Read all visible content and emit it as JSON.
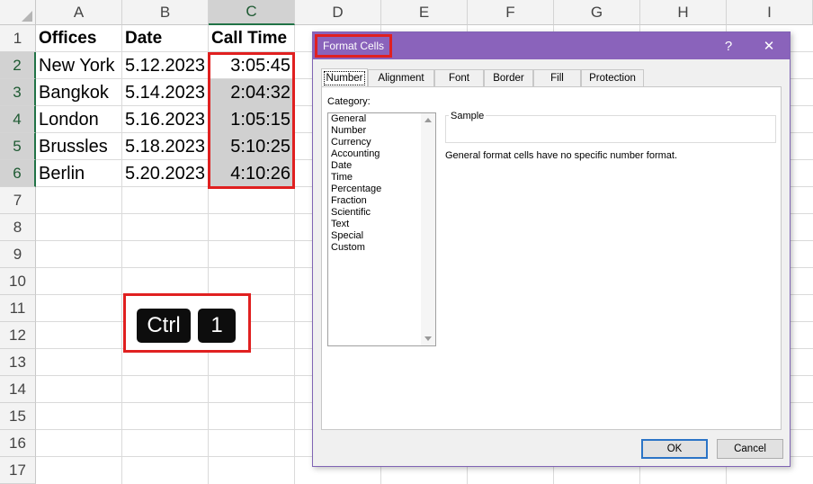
{
  "spreadsheet": {
    "columns": [
      "A",
      "B",
      "C",
      "D",
      "E",
      "F",
      "G",
      "H",
      "I"
    ],
    "rows": [
      "1",
      "2",
      "3",
      "4",
      "5",
      "6",
      "7",
      "8",
      "9",
      "10",
      "11",
      "12",
      "13",
      "14",
      "15",
      "16",
      "17"
    ],
    "headers": {
      "offices": "Offices",
      "date": "Date",
      "call_time": "Call Time"
    },
    "data": [
      {
        "office": "New York",
        "date": "5.12.2023",
        "call_time": "3:05:45"
      },
      {
        "office": "Bangkok",
        "date": "5.14.2023",
        "call_time": "2:04:32"
      },
      {
        "office": "London",
        "date": "5.16.2023",
        "call_time": "1:05:15"
      },
      {
        "office": "Brussles",
        "date": "5.18.2023",
        "call_time": "5:10:25"
      },
      {
        "office": "Berlin",
        "date": "5.20.2023",
        "call_time": "4:10:26"
      }
    ]
  },
  "shortcut": {
    "key1": "Ctrl",
    "key2": "1"
  },
  "dialog": {
    "title": "Format Cells",
    "help": "?",
    "close": "✕",
    "tabs": [
      "Number",
      "Alignment",
      "Font",
      "Border",
      "Fill",
      "Protection"
    ],
    "category_label": "Category:",
    "categories": [
      "General",
      "Number",
      "Currency",
      "Accounting",
      "Date",
      "Time",
      "Percentage",
      "Fraction",
      "Scientific",
      "Text",
      "Special",
      "Custom"
    ],
    "sample_label": "Sample",
    "description": "General format cells have no specific number format.",
    "ok": "OK",
    "cancel": "Cancel"
  },
  "colors": {
    "accent": "#217346",
    "dialog_title": "#8a63bb",
    "highlight": "#e02020",
    "selection": "#d0d0d0"
  }
}
